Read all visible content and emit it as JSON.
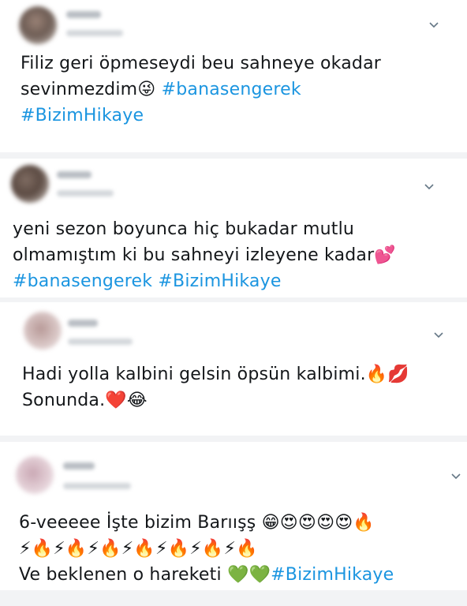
{
  "tweets": [
    {
      "lines": [
        "Filiz geri öpmeseydi beu sahneye okadar",
        "sevinmezdim😜 "
      ],
      "hashtag_1": "#banasengerek",
      "hashtag_2": "#BizimHikaye"
    },
    {
      "lines": [
        "yeni sezon boyunca hiç bukadar mutlu",
        "olmamıştım ki bu sahneyi izleyene kadar💕"
      ],
      "hashtag_1": "#banasengerek",
      "hashtag_2": "#BizimHikaye"
    },
    {
      "lines": [
        "Hadi yolla kalbini gelsin öpsün kalbimi.🔥💋",
        "Sonunda.❤️😂"
      ]
    },
    {
      "lines": [
        "6-veeeee İşte bizim Barıışş 😁😍😍😍😍🔥",
        "⚡🔥⚡🔥⚡🔥⚡🔥⚡🔥⚡🔥⚡🔥",
        "Ve beklenen o hareketi 💚💚"
      ],
      "hashtag_2": "#BizimHikaye"
    }
  ],
  "icons": {
    "caret": "chevron-down-icon"
  },
  "colors": {
    "hashtag": "#1b95e0",
    "text": "#14171a",
    "divider": "#f2f3f5"
  }
}
